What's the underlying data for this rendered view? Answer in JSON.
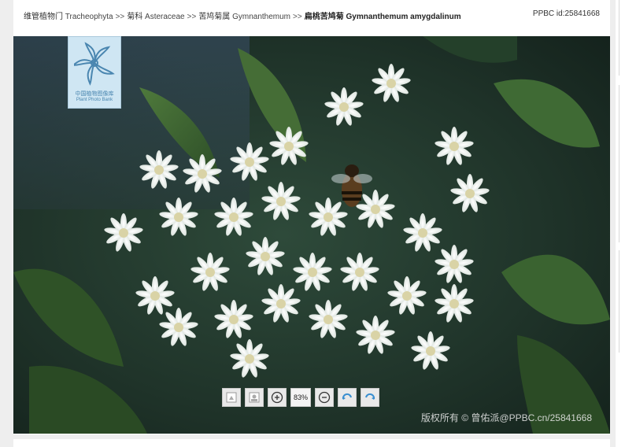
{
  "breadcrumb": {
    "phylum_cn": "维管植物门",
    "phylum_sci": "Tracheophyta",
    "family_cn": "菊科",
    "family_sci": "Asteraceae",
    "genus_cn": "苦鸠菊属",
    "genus_sci": "Gymnanthemum",
    "species": "扁桃苦鸠菊 Gymnanthemum amygdalinum",
    "separator": ">>"
  },
  "ppbc_id": "PPBC id:25841668",
  "logo": {
    "cn": "中国植物图像库",
    "en": "Plant Photo Bank"
  },
  "toolbar": {
    "zoom": "83%",
    "buttons": [
      "previous-image-icon",
      "next-image-icon",
      "zoom-in-icon",
      "zoom-out-icon",
      "rotate-left-icon",
      "rotate-right-icon"
    ]
  },
  "copyright": "版权所有 © 曾佑派@PPBC.cn/25841668",
  "colors": {
    "accent": "#4a86b0",
    "photo_bg": "#1c2a25"
  }
}
